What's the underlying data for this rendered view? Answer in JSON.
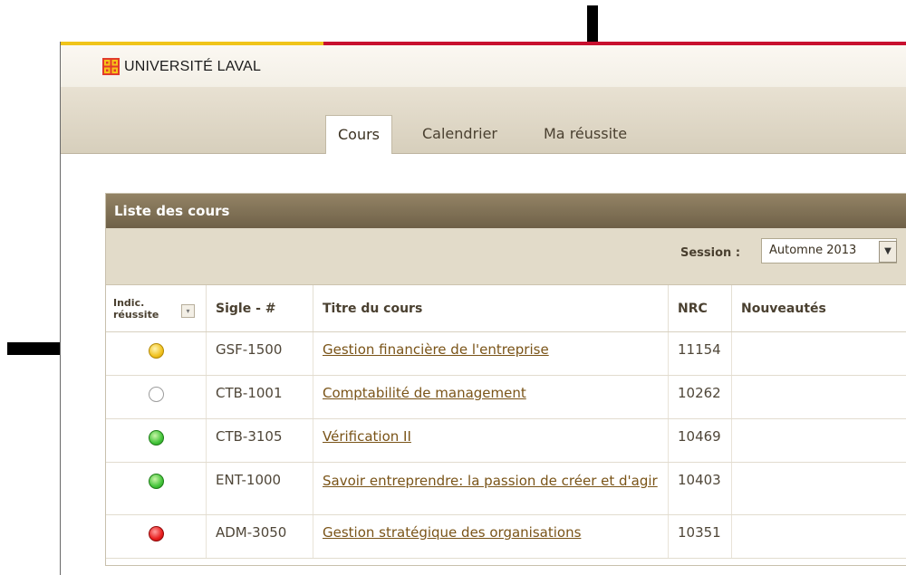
{
  "brand": {
    "name": "UNIVERSITÉ LAVAL"
  },
  "tabs": [
    {
      "label": "Cours",
      "active": true
    },
    {
      "label": "Calendrier",
      "active": false
    },
    {
      "label": "Ma réussite",
      "active": false
    }
  ],
  "panel": {
    "title": "Liste des cours",
    "session_label": "Session :",
    "session_value": "Automne 2013"
  },
  "table": {
    "headers": {
      "indic_line1": "Indic.",
      "indic_line2": "réussite",
      "sigle": "Sigle - #",
      "titre": "Titre du cours",
      "nrc": "NRC",
      "nouveautes": "Nouveautés"
    },
    "rows": [
      {
        "status": "yellow",
        "sigle": "GSF-1500",
        "titre": "Gestion financière de l'entreprise",
        "nrc": "11154",
        "nouveautes": ""
      },
      {
        "status": "gray",
        "sigle": "CTB-1001",
        "titre": "Comptabilité de management",
        "nrc": "10262",
        "nouveautes": ""
      },
      {
        "status": "green",
        "sigle": "CTB-3105",
        "titre": "Vérification II",
        "nrc": "10469",
        "nouveautes": ""
      },
      {
        "status": "green",
        "sigle": "ENT-1000",
        "titre": "Savoir entreprendre: la passion de créer et d'agir",
        "nrc": "10403",
        "nouveautes": ""
      },
      {
        "status": "red",
        "sigle": "ADM-3050",
        "titre": "Gestion stratégique des organisations",
        "nrc": "10351",
        "nouveautes": ""
      }
    ]
  },
  "colors": {
    "top_strip": "#c8102e",
    "panel_header": "#7d6e53",
    "link": "#7a5418"
  },
  "annotations": [
    {
      "icon": "arrow-down-icon",
      "points_to": "Ma réussite"
    },
    {
      "icon": "arrow-right-icon",
      "points_to": "Indic. réussite"
    }
  ]
}
